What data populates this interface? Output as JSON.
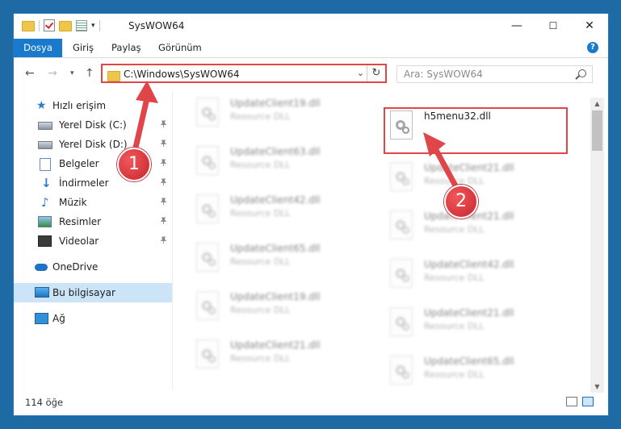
{
  "window": {
    "title": "SysWOW64",
    "controls": [
      "—",
      "☐",
      "✕"
    ]
  },
  "ribbon": {
    "tabs": [
      "Dosya",
      "Giriş",
      "Paylaş",
      "Görünüm"
    ],
    "help_label": "?"
  },
  "address": {
    "path": "C:\\Windows\\SysWOW64",
    "refresh_icon": "↻"
  },
  "search": {
    "placeholder": "Ara: SysWOW64"
  },
  "sidebar": {
    "items": [
      {
        "label": "Hızlı erişim",
        "icon": "star-icon"
      },
      {
        "label": "Yerel Disk (C:)",
        "icon": "drive-icon",
        "pinned": true
      },
      {
        "label": "Yerel Disk (D:)",
        "icon": "drive-icon",
        "pinned": true
      },
      {
        "label": "Belgeler",
        "icon": "documents-icon",
        "pinned": true
      },
      {
        "label": "İndirmeler",
        "icon": "download-icon",
        "pinned": true
      },
      {
        "label": "Müzik",
        "icon": "music-icon",
        "pinned": true
      },
      {
        "label": "Resimler",
        "icon": "pictures-icon",
        "pinned": true
      },
      {
        "label": "Videolar",
        "icon": "videos-icon",
        "pinned": true
      },
      {
        "label": "OneDrive",
        "icon": "cloud-icon"
      },
      {
        "label": "Bu bilgisayar",
        "icon": "computer-icon",
        "selected": true
      },
      {
        "label": "Ağ",
        "icon": "network-icon"
      }
    ]
  },
  "files": {
    "left_column": [
      {
        "name": "UpdateClient19.dll",
        "type": "Resource DLL"
      },
      {
        "name": "UpdateClient63.dll",
        "type": "Resource DLL"
      },
      {
        "name": "UpdateClient42.dll",
        "type": "Resource DLL"
      },
      {
        "name": "UpdateClient65.dll",
        "type": "Resource DLL"
      },
      {
        "name": "UpdateClient19.dll",
        "type": "Resource DLL"
      },
      {
        "name": "UpdateClient21.dll",
        "type": "Resource DLL"
      }
    ],
    "right_column": [
      {
        "name": "h5menu32.dll",
        "type": ""
      },
      {
        "name": "UpdateClient21.dll",
        "type": "Resource DLL"
      },
      {
        "name": "UpdateClient21.dll",
        "type": "Resource DLL"
      },
      {
        "name": "UpdateClient42.dll",
        "type": "Resource DLL"
      },
      {
        "name": "UpdateClient21.dll",
        "type": "Resource DLL"
      },
      {
        "name": "UpdateClient65.dll",
        "type": "Resource DLL"
      }
    ]
  },
  "status": {
    "item_count": "114 öğe"
  },
  "callouts": {
    "one": "1",
    "two": "2"
  },
  "colors": {
    "accent": "#1979ca",
    "callout_red": "#e04848",
    "selection": "#cce4f7"
  }
}
